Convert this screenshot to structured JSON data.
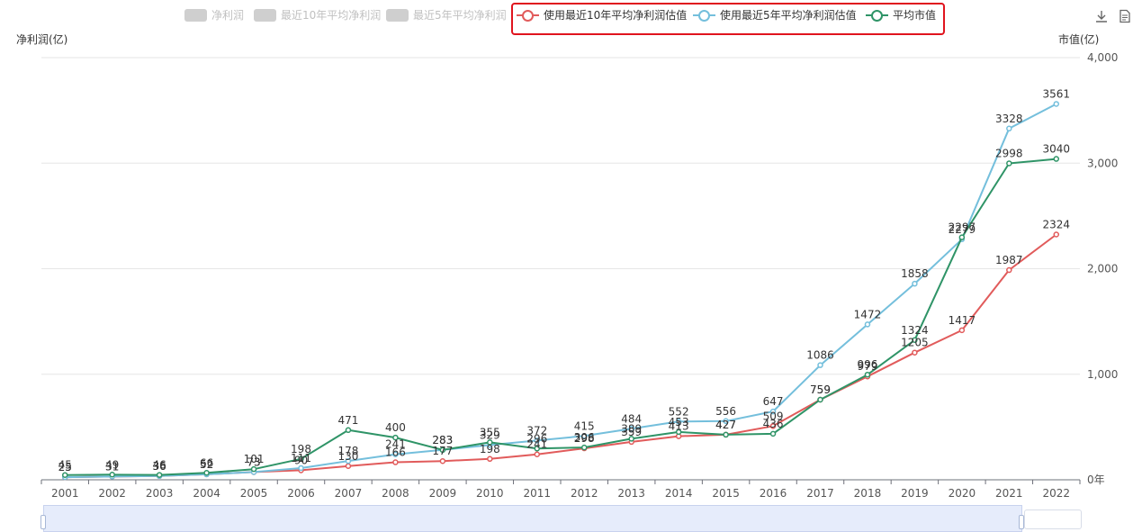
{
  "legend": {
    "items": [
      {
        "label": "净利润",
        "active": false
      },
      {
        "label": "最近10年平均净利润",
        "active": false
      },
      {
        "label": "最近5年平均净利润",
        "active": false
      },
      {
        "label": "使用最近10年平均净利润估值",
        "active": true,
        "color": "#e15b5b"
      },
      {
        "label": "使用最近5年平均净利润估值",
        "active": true,
        "color": "#74bfdc"
      },
      {
        "label": "平均市值",
        "active": true,
        "color": "#2f9467"
      }
    ]
  },
  "toolbar": {
    "download_icon": "download-icon",
    "data_view_icon": "document-icon"
  },
  "chart_data": {
    "type": "line",
    "left_axis_name": "净利润(亿)",
    "right_axis_name": "市值(亿)",
    "x": [
      "2001",
      "2002",
      "2003",
      "2004",
      "2005",
      "2006",
      "2007",
      "2008",
      "2009",
      "2010",
      "2011",
      "2012",
      "2013",
      "2014",
      "2015",
      "2016",
      "2017",
      "2018",
      "2019",
      "2020",
      "2021",
      "2022"
    ],
    "right_ticks": [
      "0年",
      "1,000",
      "2,000",
      "3,000",
      "4,000"
    ],
    "ylim": [
      0,
      4000
    ],
    "grid": true,
    "series": [
      {
        "name": "使用最近10年平均净利润估值",
        "color": "#e15b5b",
        "values": [
          25,
          31,
          36,
          52,
          73,
          90,
          130,
          166,
          177,
          198,
          241,
          298,
          359,
          413,
          427,
          509,
          759,
          979,
          1205,
          1417,
          1987,
          2324
        ]
      },
      {
        "name": "使用最近5年平均净利润估值",
        "color": "#74bfdc",
        "values": [
          25,
          31,
          36,
          52,
          73,
          111,
          178,
          241,
          283,
          329,
          372,
          415,
          484,
          552,
          556,
          647,
          1086,
          1472,
          1858,
          2279,
          3328,
          3561
        ]
      },
      {
        "name": "平均市值",
        "color": "#2f9467",
        "values": [
          45,
          49,
          46,
          66,
          101,
          198,
          471,
          400,
          283,
          355,
          296,
          306,
          389,
          453,
          427,
          436,
          759,
          996,
          1324,
          2297,
          2998,
          3040
        ]
      }
    ]
  }
}
